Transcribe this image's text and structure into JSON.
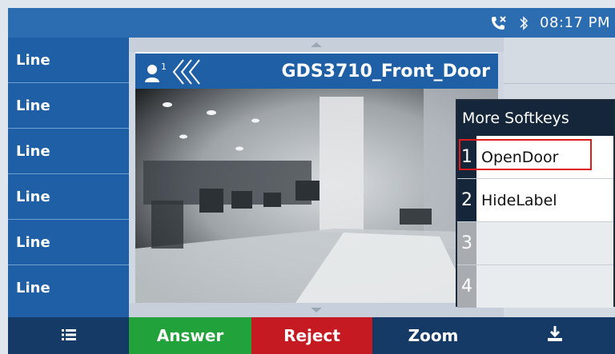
{
  "status": {
    "time": "08:17 PM"
  },
  "line_keys": [
    "Line",
    "Line",
    "Line",
    "Line",
    "Line",
    "Line"
  ],
  "call": {
    "name": "GDS3710_Front_Door",
    "count": "1"
  },
  "popup": {
    "title": "More Softkeys",
    "items": [
      {
        "num": "1",
        "label": "OpenDoor"
      },
      {
        "num": "2",
        "label": "HideLabel"
      },
      {
        "num": "3",
        "label": ""
      },
      {
        "num": "4",
        "label": ""
      }
    ]
  },
  "softkeys": {
    "answer": "Answer",
    "reject": "Reject",
    "zoom": "Zoom"
  },
  "colors": {
    "status_bar": "#2b6db0",
    "line_keys": "#1f5fa6",
    "answer": "#22a23a",
    "reject": "#c51a22",
    "softkey_bar": "#163a66"
  },
  "icons": [
    "missed-call-icon",
    "bluetooth-icon",
    "menu-list-icon",
    "download-icon",
    "person-icon"
  ]
}
